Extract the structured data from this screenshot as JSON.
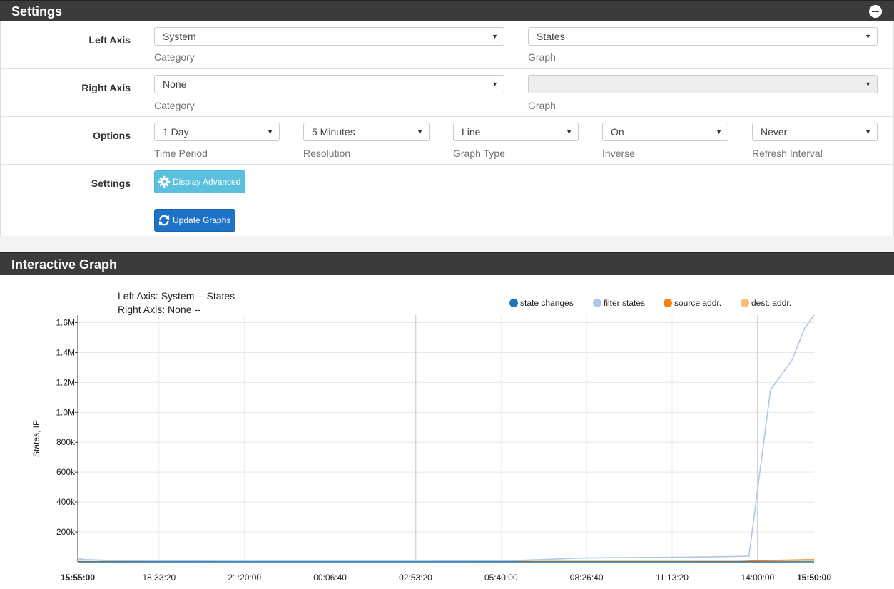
{
  "settings_panel": {
    "title": "Settings",
    "left_axis": {
      "label": "Left Axis",
      "category_value": "System",
      "category_help": "Category",
      "graph_value": "States",
      "graph_help": "Graph"
    },
    "right_axis": {
      "label": "Right Axis",
      "category_value": "None",
      "category_help": "Category",
      "graph_value": "",
      "graph_help": "Graph"
    },
    "options": {
      "label": "Options",
      "time_period_value": "1 Day",
      "time_period_help": "Time Period",
      "resolution_value": "5 Minutes",
      "resolution_help": "Resolution",
      "graph_type_value": "Line",
      "graph_type_help": "Graph Type",
      "inverse_value": "On",
      "inverse_help": "Inverse",
      "refresh_value": "Never",
      "refresh_help": "Refresh Interval"
    },
    "advanced": {
      "label": "Settings",
      "button_label": "Display Advanced"
    },
    "update_button_label": "Update Graphs"
  },
  "graph_panel": {
    "title": "Interactive Graph",
    "left_axis_caption": "Left Axis: System -- States",
    "right_axis_caption": "Right Axis: None --"
  },
  "colors": {
    "header_bg": "#3b3b3b",
    "info_button": "#5bc0de",
    "primary_button": "#1e73c8"
  },
  "chart_data": {
    "type": "line",
    "ylabel": "States, IP",
    "ylim": [
      0,
      1650000
    ],
    "y_ticks": [
      "200k",
      "400k",
      "600k",
      "800k",
      "1.0M",
      "1.2M",
      "1.4M",
      "1.6M"
    ],
    "y_tick_values": [
      200000,
      400000,
      600000,
      800000,
      1000000,
      1200000,
      1400000,
      1600000
    ],
    "x_ticks": [
      "15:55:00",
      "18:33:20",
      "21:20:00",
      "00:06:40",
      "02:53:20",
      "05:40:00",
      "08:26:40",
      "11:13:20",
      "14:00:00",
      "15:50:00"
    ],
    "x_tick_hours": [
      0,
      2.6389,
      5.4167,
      8.1944,
      10.9722,
      13.75,
      16.5278,
      19.3056,
      22.0833,
      23.9167
    ],
    "x_bold_ticks": [
      "15:55:00",
      "15:50:00"
    ],
    "x_range_hours": [
      0,
      23.9167
    ],
    "x_dim_gridlines_hours": [
      10.9722,
      22.0833
    ],
    "legend": [
      "state changes",
      "filter states",
      "source addr.",
      "dest. addr."
    ],
    "legend_position": "top-right",
    "series": [
      {
        "name": "state changes",
        "color": "#1f77b4",
        "x": [
          0,
          23.9167
        ],
        "values": [
          0,
          0
        ]
      },
      {
        "name": "filter states",
        "color": "#aec7e8",
        "x": [
          0,
          0.3,
          1.0,
          2.5,
          5.0,
          8.0,
          11.0,
          14.0,
          15.0,
          16.2,
          17.0,
          19.0,
          20.0,
          21.0,
          21.8,
          22.5,
          23.2,
          23.6,
          23.9167
        ],
        "values": [
          20000,
          15000,
          10000,
          7000,
          5000,
          5000,
          5000,
          8000,
          15000,
          25000,
          27000,
          30000,
          32000,
          35000,
          38000,
          1150000,
          1350000,
          1560000,
          1650000
        ]
      },
      {
        "name": "source addr.",
        "color": "#ff7f0e",
        "x": [
          0,
          21.5,
          22.5,
          23.9167
        ],
        "values": [
          2000,
          3000,
          10000,
          15000
        ]
      },
      {
        "name": "dest. addr.",
        "color": "#ffbb78",
        "x": [
          0,
          21.5,
          22.5,
          23.9167
        ],
        "values": [
          1000,
          2000,
          6000,
          8000
        ]
      }
    ]
  }
}
